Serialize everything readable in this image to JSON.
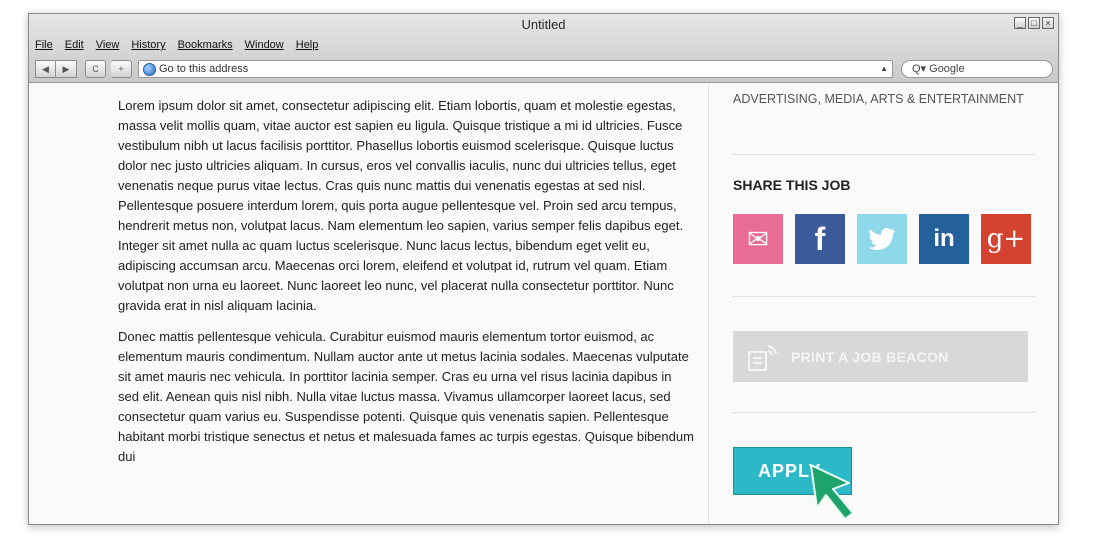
{
  "window": {
    "title": "Untitled",
    "controls": [
      "_",
      "□",
      "×"
    ]
  },
  "menu": [
    "File",
    "Edit",
    "View",
    "History",
    "Bookmarks",
    "Window",
    "Help"
  ],
  "toolbar": {
    "back_icon": "◀",
    "forward_icon": "▶",
    "reload_icon": "C",
    "add_icon": "+",
    "address_placeholder": "Go to this address",
    "search_placeholder": "Q▾ Google"
  },
  "article": {
    "paragraphs": [
      "Lorem ipsum dolor sit amet, consectetur adipiscing elit. Etiam lobortis, quam et molestie egestas, massa velit mollis quam, vitae auctor est sapien eu ligula. Quisque tristique a mi id ultricies. Fusce vestibulum nibh ut lacus facilisis porttitor. Phasellus lobortis euismod scelerisque. Quisque luctus dolor nec justo ultricies aliquam. In cursus, eros vel convallis iaculis, nunc dui ultricies tellus, eget venenatis neque purus vitae lectus. Cras quis nunc mattis dui venenatis egestas at sed nisl. Pellentesque posuere interdum lorem, quis porta augue pellentesque vel. Proin sed arcu tempus, hendrerit metus non, volutpat lacus. Nam elementum leo sapien, varius semper felis dapibus eget. Integer sit amet nulla ac quam luctus scelerisque. Nunc lacus lectus, bibendum eget velit eu, adipiscing accumsan arcu. Maecenas orci lorem, eleifend et volutpat id, rutrum vel quam. Etiam volutpat non urna eu laoreet. Nunc laoreet leo nunc, vel placerat nulla consectetur porttitor. Nunc gravida erat in nisl aliquam lacinia.",
      "Donec mattis pellentesque vehicula. Curabitur euismod mauris elementum tortor euismod, ac elementum mauris condimentum. Nullam auctor ante ut metus lacinia sodales. Maecenas vulputate sit amet mauris nec vehicula. In porttitor lacinia semper. Cras eu urna vel risus lacinia dapibus in sed elit. Aenean quis nisl nibh. Nulla vitae luctus massa. Vivamus ullamcorper laoreet lacus, sed consectetur quam varius eu. Suspendisse potenti. Quisque quis venenatis sapien. Pellentesque habitant morbi tristique senectus et netus et malesuada fames ac turpis egestas. Quisque bibendum dui"
    ]
  },
  "sidebar": {
    "category": "ADVERTISING, MEDIA, ARTS & ENTERTAINMENT",
    "share_title": "SHARE THIS JOB",
    "social": {
      "email_label": "✉",
      "facebook_label": "f",
      "twitter_label": "",
      "linkedin_label": "in",
      "googleplus_label": "g+"
    },
    "beacon_label": "PRINT A JOB BEACON",
    "apply_label": "APPLY"
  },
  "colors": {
    "email": "#e86c93",
    "facebook": "#3b5a9a",
    "twitter": "#8fd7ea",
    "linkedin": "#24609c",
    "googleplus": "#d4432f",
    "apply": "#2cb8c7",
    "cursor": "#1fa36d"
  }
}
